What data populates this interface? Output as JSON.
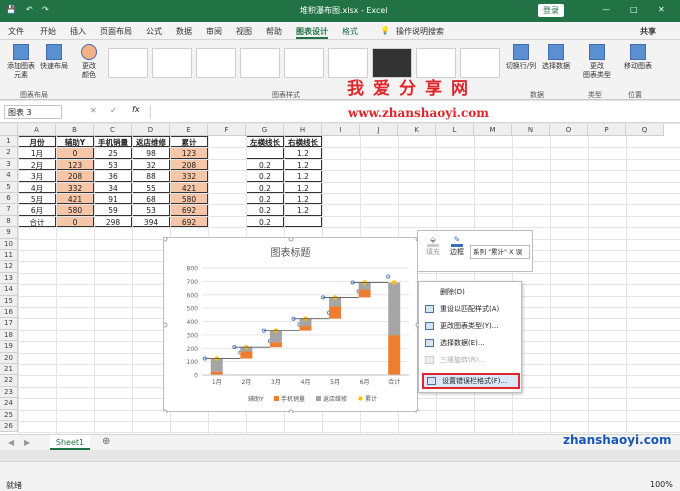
{
  "window": {
    "title": "堆积瀑布图.xlsx - Excel",
    "login": "登录",
    "share": "共享"
  },
  "menu": [
    "文件",
    "开始",
    "插入",
    "页面布局",
    "公式",
    "数据",
    "审阅",
    "视图",
    "帮助",
    "图表设计",
    "格式"
  ],
  "search": "操作说明搜索",
  "ribbon": {
    "add_element": "添加图表\n元素",
    "quick_layout": "快速布局",
    "change_color": "更改\n颜色",
    "group_layout": "图表布局",
    "group_styles": "图表样式",
    "switch_rowcol": "切换行/列",
    "select_data": "选择数据",
    "group_data": "数据",
    "change_type": "更改\n图表类型",
    "group_type": "类型",
    "move_chart": "移动图表",
    "group_location": "位置"
  },
  "namebox": "图表 3",
  "formula": "",
  "columns": [
    "A",
    "B",
    "C",
    "D",
    "E",
    "F",
    "G",
    "H",
    "I",
    "J",
    "K",
    "L",
    "M",
    "N",
    "O",
    "P",
    "Q"
  ],
  "rows": [
    "1",
    "2",
    "3",
    "4",
    "5",
    "6",
    "7",
    "8",
    "9",
    "10",
    "11",
    "12",
    "13",
    "14",
    "15",
    "16",
    "17",
    "18",
    "19",
    "20",
    "21",
    "22",
    "23",
    "24",
    "25",
    "26"
  ],
  "table": {
    "headers": [
      "月份",
      "辅助Y",
      "手机销量",
      "返店维修",
      "累计"
    ],
    "rows": [
      [
        "1月",
        "0",
        "25",
        "98",
        "123"
      ],
      [
        "2月",
        "123",
        "53",
        "32",
        "208"
      ],
      [
        "3月",
        "208",
        "36",
        "88",
        "332"
      ],
      [
        "4月",
        "332",
        "34",
        "55",
        "421"
      ],
      [
        "5月",
        "421",
        "91",
        "68",
        "580"
      ],
      [
        "6月",
        "580",
        "59",
        "53",
        "692"
      ],
      [
        "合计",
        "0",
        "298",
        "394",
        "692"
      ]
    ]
  },
  "table2": {
    "headers": [
      "左横线长",
      "右横线长"
    ],
    "rows": [
      [
        "",
        "1.2"
      ],
      [
        "0.2",
        "1.2"
      ],
      [
        "0.2",
        "1.2"
      ],
      [
        "0.2",
        "1.2"
      ],
      [
        "0.2",
        "1.2"
      ],
      [
        "0.2",
        "1.2"
      ],
      [
        "0.2",
        ""
      ]
    ]
  },
  "chart_data": {
    "type": "bar",
    "title": "图表标题",
    "categories": [
      "1月",
      "2月",
      "3月",
      "4月",
      "5月",
      "6月",
      "合计"
    ],
    "series": [
      {
        "name": "辅助Y",
        "values": [
          0,
          123,
          208,
          332,
          421,
          580,
          0
        ]
      },
      {
        "name": "手机销量",
        "values": [
          25,
          53,
          36,
          34,
          91,
          59,
          298
        ]
      },
      {
        "name": "返店维修",
        "values": [
          98,
          32,
          88,
          55,
          68,
          53,
          394
        ]
      },
      {
        "name": "累计",
        "values": [
          123,
          208,
          332,
          421,
          580,
          692,
          692
        ]
      }
    ],
    "yticks": [
      "0",
      "100",
      "200",
      "300",
      "400",
      "500",
      "600",
      "700",
      "800"
    ],
    "ylim": [
      0,
      800
    ],
    "colors": {
      "手机销量": "#ed7d31",
      "返店维修": "#a5a5a5",
      "累计": "#ffc000"
    }
  },
  "minibar": {
    "fill": "填充",
    "outline": "边框",
    "series_select": "系列 \"累计\" X 误"
  },
  "context_menu": [
    {
      "label": "删除(D)",
      "enabled": true
    },
    {
      "label": "重设以匹配样式(A)",
      "enabled": true
    },
    {
      "label": "更改图表类型(Y)...",
      "enabled": true
    },
    {
      "label": "选择数据(E)...",
      "enabled": true
    },
    {
      "label": "三维旋转(R)...",
      "enabled": false
    },
    {
      "label": "设置错误栏格式(F)...",
      "enabled": true,
      "highlight": true
    }
  ],
  "sheet_tab": "Sheet1",
  "status": {
    "ready": "就绪",
    "zoom": "100%"
  },
  "watermark": {
    "title": "我爱分享网",
    "url": "www.zhanshaoyi.com",
    "corner": "zhanshaoyi.com"
  }
}
